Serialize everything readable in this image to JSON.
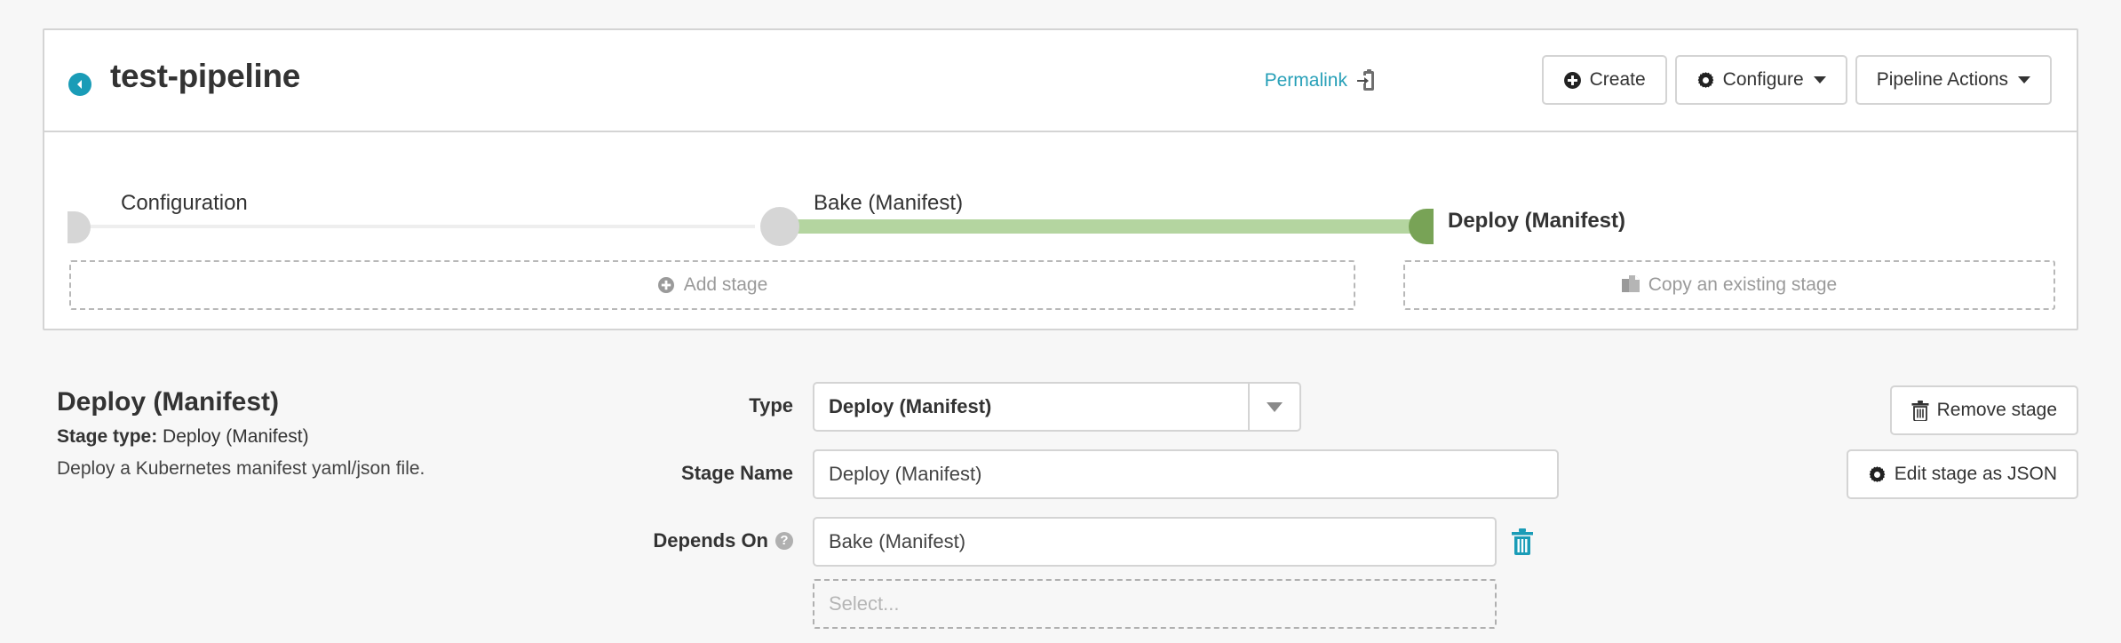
{
  "header": {
    "back_icon": "back-arrow-icon",
    "title": "test-pipeline",
    "permalink_label": "Permalink",
    "permalink_icon": "copy-to-clipboard-icon",
    "buttons": [
      {
        "label": "Create",
        "icon": "plus-circle-icon",
        "has_caret": false
      },
      {
        "label": "Configure",
        "icon": "gear-icon",
        "has_caret": true
      },
      {
        "label": "Pipeline Actions",
        "icon": null,
        "has_caret": true
      }
    ]
  },
  "graph": {
    "stages": [
      {
        "label": "Configuration",
        "state": "inactive",
        "selected": false
      },
      {
        "label": "Bake (Manifest)",
        "state": "inactive",
        "selected": false
      },
      {
        "label": "Deploy (Manifest)",
        "state": "active",
        "selected": true
      }
    ],
    "add_stage_label": "Add stage",
    "add_stage_icon": "plus-circle-icon",
    "copy_stage_label": "Copy an existing stage",
    "copy_stage_icon": "copy-files-icon"
  },
  "stage_details": {
    "title": "Deploy (Manifest)",
    "stage_type_label": "Stage type:",
    "stage_type_value": "Deploy (Manifest)",
    "description": "Deploy a Kubernetes manifest yaml/json file.",
    "form": {
      "type_label": "Type",
      "type_value": "Deploy (Manifest)",
      "stage_name_label": "Stage Name",
      "stage_name_value": "Deploy (Manifest)",
      "depends_on_label": "Depends On",
      "depends_on_help_icon": "question-mark-icon",
      "depends_on_value": "Bake (Manifest)",
      "depends_on_delete_icon": "trash-icon",
      "depends_on_add_placeholder": "Select..."
    },
    "actions": [
      {
        "label": "Remove stage",
        "icon": "trash-icon"
      },
      {
        "label": "Edit stage as JSON",
        "icon": "gear-icon"
      }
    ]
  },
  "colors": {
    "accent_teal": "#28a0b8",
    "stage_active_green": "#78a356",
    "stage_line_green": "#b4d5a0",
    "stage_inactive_grey": "#d6d6d6",
    "page_background": "#f7f7f7"
  }
}
